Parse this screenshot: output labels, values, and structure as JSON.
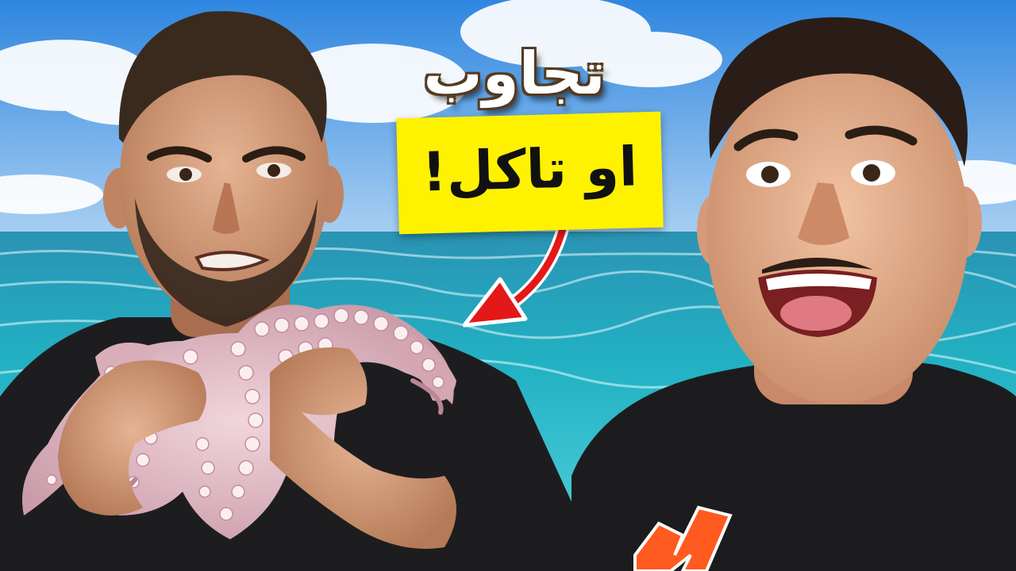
{
  "thumbnail": {
    "headline": "تجاوب",
    "banner": "او تاكل!"
  },
  "colors": {
    "sky_top": "#2f86e0",
    "sky_bottom": "#9cc8ef",
    "sea": "#1fa7b8",
    "banner_bg": "#fff200",
    "arrow": "#e41818",
    "headline_text": "#ffffff",
    "banner_text": "#111111"
  }
}
